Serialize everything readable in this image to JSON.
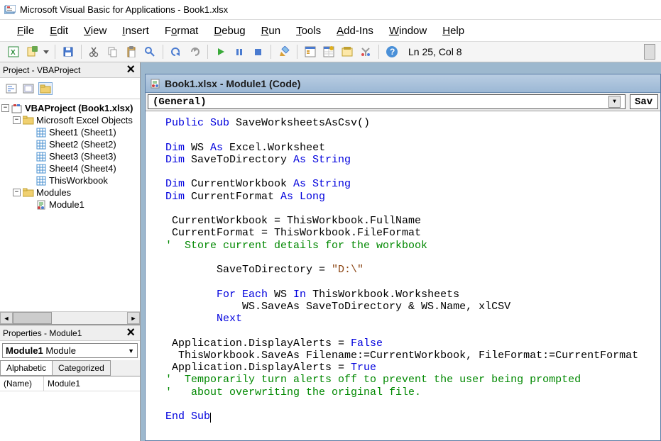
{
  "title": "Microsoft Visual Basic for Applications - Book1.xlsx",
  "menu": [
    "File",
    "Edit",
    "View",
    "Insert",
    "Format",
    "Debug",
    "Run",
    "Tools",
    "Add-Ins",
    "Window",
    "Help"
  ],
  "menuAccel": [
    "F",
    "E",
    "V",
    "I",
    "o",
    "D",
    "R",
    "T",
    "A",
    "W",
    "H"
  ],
  "cursorPos": "Ln 25, Col 8",
  "project": {
    "header": "Project - VBAProject",
    "root": "VBAProject (Book1.xlsx)",
    "excelObjects": "Microsoft Excel Objects",
    "sheets": [
      "Sheet1 (Sheet1)",
      "Sheet2 (Sheet2)",
      "Sheet3 (Sheet3)",
      "Sheet4 (Sheet4)",
      "ThisWorkbook"
    ],
    "modulesFolder": "Modules",
    "modules": [
      "Module1"
    ]
  },
  "properties": {
    "header": "Properties - Module1",
    "objName": "Module1",
    "objType": "Module",
    "tabs": [
      "Alphabetic",
      "Categorized"
    ],
    "rows": [
      [
        "(Name)",
        "Module1"
      ]
    ]
  },
  "codeWindow": {
    "title": "Book1.xlsx - Module1 (Code)",
    "ddLeft": "(General)",
    "ddRight": "SaveWorksheetsAsCsv"
  },
  "code": {
    "l1a": "Public Sub",
    "l1b": " SaveWorksheetsAsCsv()",
    "l2a": "Dim",
    "l2b": " WS ",
    "l2c": "As",
    "l2d": " Excel.Worksheet",
    "l3a": "Dim",
    "l3b": " SaveToDirectory ",
    "l3c": "As String",
    "l4a": "Dim",
    "l4b": " CurrentWorkbook ",
    "l4c": "As String",
    "l5a": "Dim",
    "l5b": " CurrentFormat ",
    "l5c": "As Long",
    "l6": " CurrentWorkbook = ThisWorkbook.FullName",
    "l7": " CurrentFormat = ThisWorkbook.FileFormat",
    "l8": "'  Store current details for the workbook",
    "l9a": "        SaveToDirectory = ",
    "l9b": "\"D:\\\"",
    "l10a": "        ",
    "l10b": "For Each",
    "l10c": " WS ",
    "l10d": "In",
    "l10e": " ThisWorkbook.Worksheets",
    "l11": "            WS.SaveAs SaveToDirectory & WS.Name, xlCSV",
    "l12a": "        ",
    "l12b": "Next",
    "l13a": " Application.DisplayAlerts = ",
    "l13b": "False",
    "l14": "  ThisWorkbook.SaveAs Filename:=CurrentWorkbook, FileFormat:=CurrentFormat",
    "l15a": " Application.DisplayAlerts = ",
    "l15b": "True",
    "l16": "'  Temporarily turn alerts off to prevent the user being prompted",
    "l17": "'   about overwriting the original file.",
    "l18": "End Sub"
  }
}
